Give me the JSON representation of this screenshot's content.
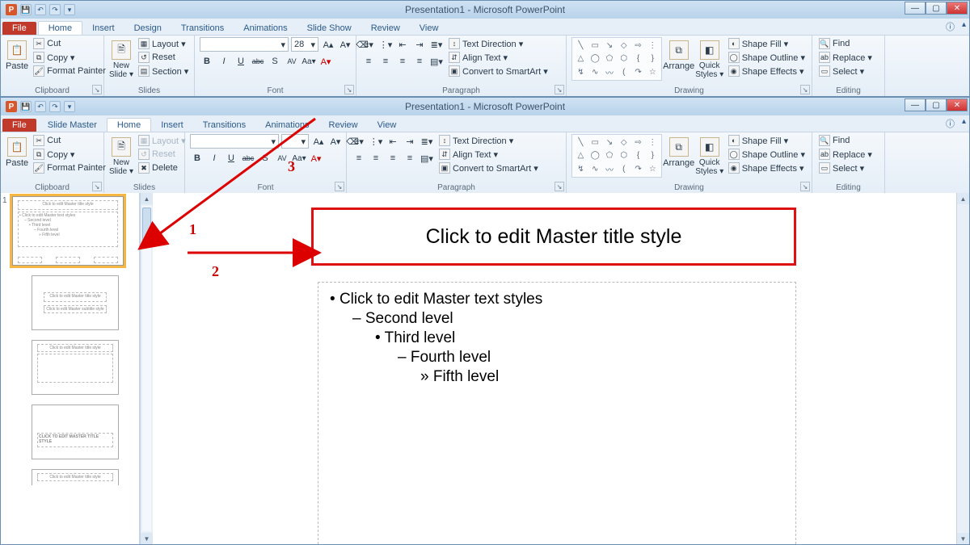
{
  "app_title": "Presentation1 - Microsoft PowerPoint",
  "qat": {
    "save": "💾",
    "undo": "↶",
    "redo": "↷"
  },
  "win1": {
    "tabs": {
      "file": "File",
      "home": "Home",
      "insert": "Insert",
      "design": "Design",
      "transitions": "Transitions",
      "animations": "Animations",
      "slideshow": "Slide Show",
      "review": "Review",
      "view": "View"
    }
  },
  "win2": {
    "tabs": {
      "file": "File",
      "slidemaster": "Slide Master",
      "home": "Home",
      "insert": "Insert",
      "transitions": "Transitions",
      "animations": "Animations",
      "review": "Review",
      "view": "View"
    }
  },
  "clipboard": {
    "label": "Clipboard",
    "paste": "Paste",
    "cut": "Cut",
    "copy": "Copy ▾",
    "format_painter": "Format Painter"
  },
  "slides": {
    "label": "Slides",
    "new_slide": "New\nSlide ▾",
    "layout": "Layout ▾",
    "reset": "Reset",
    "section": "Section ▾",
    "delete": "Delete"
  },
  "font": {
    "label": "Font",
    "size": "28",
    "grow": "A▴",
    "shrink": "A▾",
    "clear": "⌫",
    "bold": "B",
    "italic": "I",
    "underline": "U",
    "strike": "abc",
    "shadow": "S",
    "spacing": "AV",
    "case": "Aa▾",
    "color": "A▾"
  },
  "paragraph": {
    "label": "Paragraph",
    "bullets": "≡▾",
    "numbers": "⋮▾",
    "indent_dec": "⇤",
    "indent_inc": "⇥",
    "linesp": "≣▾",
    "text_direction": "Text Direction ▾",
    "align_text": "Align Text ▾",
    "smartart": "Convert to SmartArt ▾",
    "al": "≡",
    "ac": "≡",
    "ar": "≡",
    "aj": "≡",
    "cols": "▤▾"
  },
  "drawing": {
    "label": "Drawing",
    "arrange": "Arrange",
    "quick": "Quick\nStyles ▾",
    "fill": "Shape Fill ▾",
    "outline": "Shape Outline ▾",
    "effects": "Shape Effects ▾"
  },
  "editing": {
    "label": "Editing",
    "find": "Find",
    "replace": "Replace ▾",
    "select": "Select ▾"
  },
  "shapes": [
    "╲",
    "▭",
    "↘",
    "◇",
    "⇨",
    "☐",
    "△",
    "◯",
    "⬠",
    "⬡",
    "{",
    "}",
    "↯",
    "∿",
    "〰",
    "(",
    "}",
    "↷",
    "☆",
    "⋮"
  ],
  "master": {
    "title": "Click to edit Master title style",
    "body1": "Click to edit Master text styles",
    "body2": "Second level",
    "body3": "Third level",
    "body4": "Fourth level",
    "body5": "Fifth level"
  },
  "thumbs": {
    "t1_title": "Click to edit Master title style",
    "t1_l1": "Click to edit Master text styles",
    "t1_l2": "Second level",
    "t1_l3": "Third level",
    "t1_l4": "Fourth level",
    "t1_l5": "Fifth level",
    "t2_title": "Click to edit Master title style",
    "t2_sub": "Click to edit Master subtitle style",
    "t3_title": "Click to edit Master title style",
    "t4_title": "CLICK TO EDIT MASTER TITLE STYLE",
    "t5_title": "Click to edit Master title style"
  },
  "annotations": {
    "a1": "1",
    "a2": "2",
    "a3": "3"
  }
}
